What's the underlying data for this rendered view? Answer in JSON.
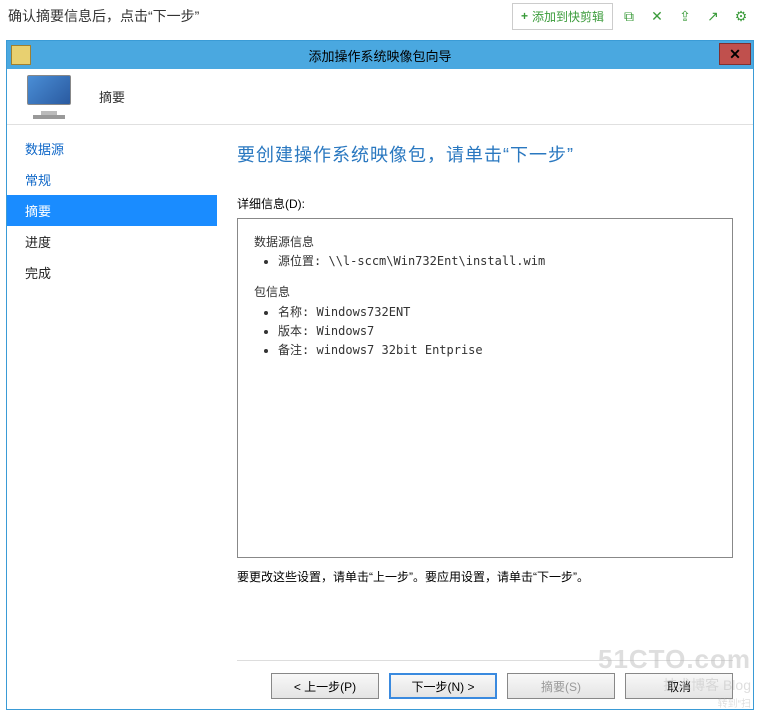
{
  "page": {
    "instruction": "确认摘要信息后，点击“下一步”"
  },
  "top_toolbar": {
    "add_snip": "添加到快剪辑",
    "icons": [
      "copy",
      "expand",
      "share",
      "export",
      "settings"
    ]
  },
  "titlebar": {
    "title": "添加操作系统映像包向导"
  },
  "header": {
    "title": "摘要"
  },
  "sidebar": {
    "items": [
      {
        "label": "数据源",
        "state": "link"
      },
      {
        "label": "常规",
        "state": "link"
      },
      {
        "label": "摘要",
        "state": "selected"
      },
      {
        "label": "进度",
        "state": "plain"
      },
      {
        "label": "完成",
        "state": "plain"
      }
    ]
  },
  "main": {
    "heading": "要创建操作系统映像包，请单击“下一步”",
    "detail_label": "详细信息(D):",
    "hint": "要更改这些设置，请单击“上一步”。要应用设置，请单击“下一步”。"
  },
  "details": {
    "group1_title": "数据源信息",
    "group1_item1_label": "源位置:",
    "group1_item1_value": "\\\\l-sccm\\Win732Ent\\install.wim",
    "group2_title": "包信息",
    "group2_item1_label": "名称:",
    "group2_item1_value": "Windows732ENT",
    "group2_item2_label": "版本:",
    "group2_item2_value": "Windows7",
    "group2_item3_label": "备注:",
    "group2_item3_value": "windows7 32bit Entprise"
  },
  "buttons": {
    "prev": "< 上一步(P)",
    "next": "下一步(N) >",
    "summary": "摘要(S)",
    "cancel": "取消"
  },
  "watermark": {
    "l1": "51CTO.com",
    "l2": "技术博客  Blog",
    "l3": "转到“扫"
  }
}
